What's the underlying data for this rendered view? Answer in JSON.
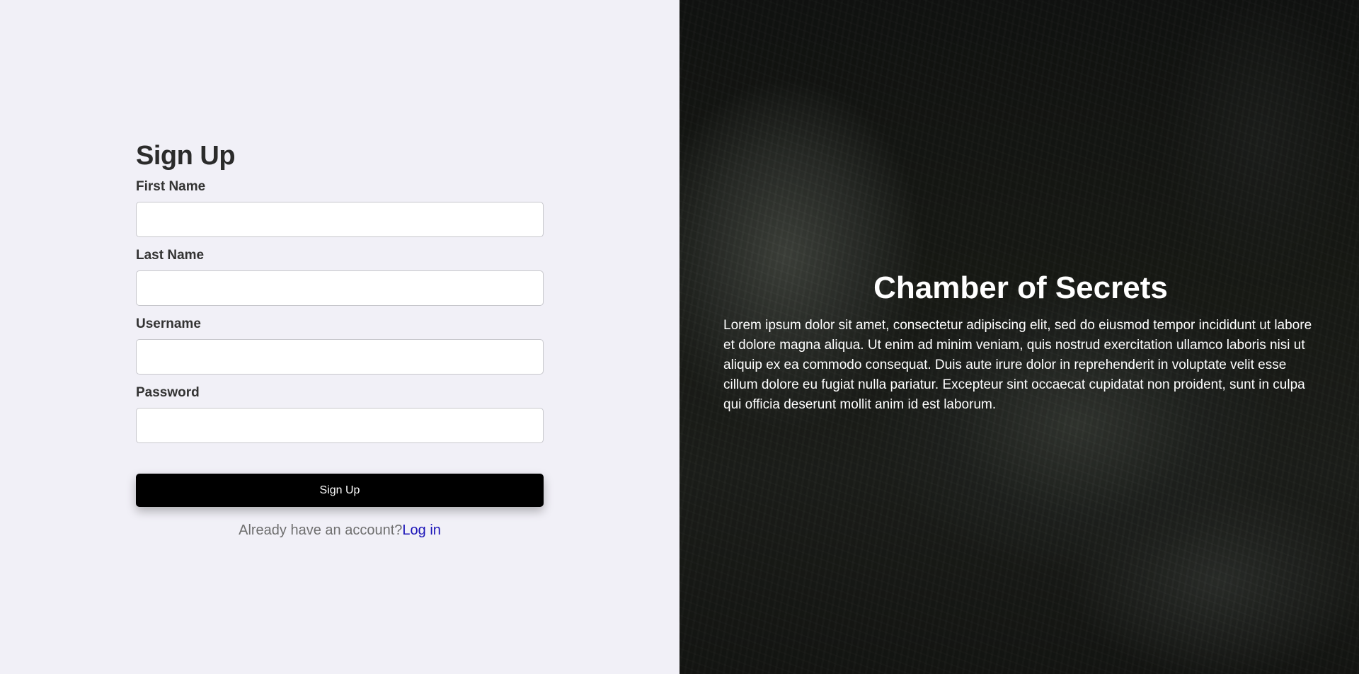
{
  "signup": {
    "title": "Sign Up",
    "fields": [
      {
        "label": "First Name",
        "value": "",
        "placeholder": ""
      },
      {
        "label": "Last Name",
        "value": "",
        "placeholder": ""
      },
      {
        "label": "Username",
        "value": "",
        "placeholder": ""
      },
      {
        "label": "Password",
        "value": "",
        "placeholder": ""
      }
    ],
    "submit_label": "Sign Up",
    "login_prompt": "Already have an account?",
    "login_link": "Log in"
  },
  "hero": {
    "title": "Chamber of Secrets",
    "text": "Lorem ipsum dolor sit amet, consectetur adipiscing elit, sed do eiusmod tempor incididunt ut labore et dolore magna aliqua. Ut enim ad minim veniam, quis nostrud exercitation ullamco laboris nisi ut aliquip ex ea commodo consequat. Duis aute irure dolor in reprehenderit in voluptate velit esse cillum dolore eu fugiat nulla pariatur. Excepteur sint occaecat cupidatat non proident, sunt in culpa qui officia deserunt mollit anim id est laborum."
  },
  "colors": {
    "panel_background": "#f1f0f7",
    "button_background": "#000000",
    "link": "#1b14b8",
    "hero_text": "#ffffff"
  }
}
